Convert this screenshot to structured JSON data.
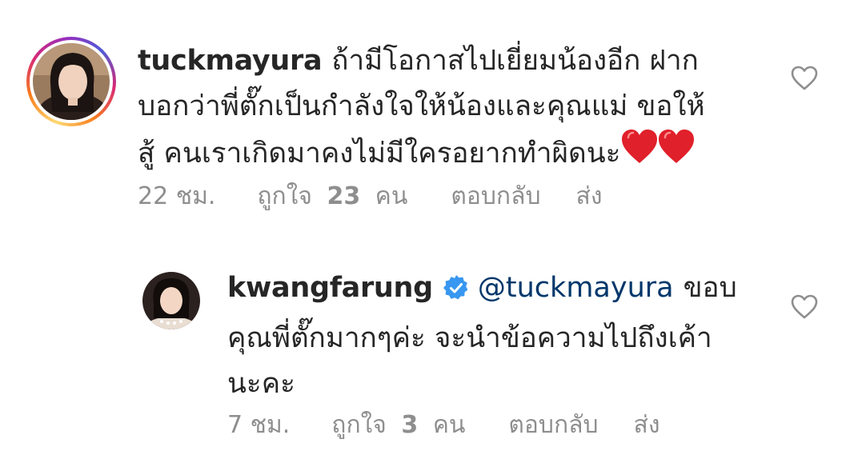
{
  "comments": [
    {
      "username": "tuckmayura",
      "text_lines": [
        "ถ้ามีโอกาสไปเยี่ยมน้องอีก ฝาก",
        "บอกว่าพี่ตั๊กเป็นกำลังใจให้น้องและคุณแม่ ขอให้",
        "สู้ คนเราเกิดมาคงไม่มีใครอยากทำผิดนะ"
      ],
      "emoji": "heart-heart",
      "time": "22 ชม.",
      "likes_prefix": "ถูกใจ",
      "likes_count": "23",
      "likes_suffix": "คน",
      "reply_label": "ตอบกลับ",
      "send_label": "ส่ง"
    },
    {
      "username": "kwangfarung",
      "verified": true,
      "mention": "@tuckmayura",
      "text_lines": [
        "ขอบ",
        "คุณพี่ตั๊กมากๆค่ะ จะนำข้อความไปถึงเค้า",
        "นะคะ"
      ],
      "time": "7 ชม.",
      "likes_prefix": "ถูกใจ",
      "likes_count": "3",
      "likes_suffix": "คน",
      "reply_label": "ตอบกลับ",
      "send_label": "ส่ง"
    }
  ],
  "colors": {
    "text": "#262626",
    "meta": "#8e8e8e",
    "mention": "#00376b",
    "verified": "#3897f0",
    "heart": "#e0202a"
  },
  "icons": {
    "like": "heart-outline-icon",
    "verified": "verified-badge-icon"
  }
}
